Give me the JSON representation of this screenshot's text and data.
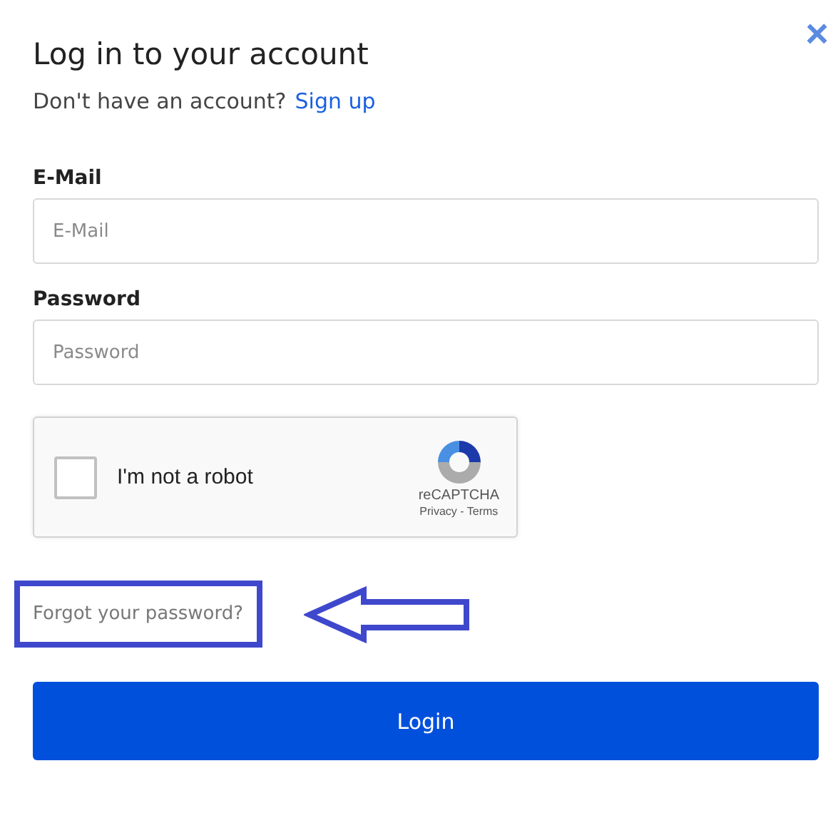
{
  "dialog": {
    "title": "Log in to your account",
    "subtitle": "Don't have an account?",
    "signup_link": "Sign up",
    "close": "×"
  },
  "fields": [
    {
      "label": "E-Mail",
      "placeholder": "E-Mail"
    },
    {
      "label": "Password",
      "placeholder": "Password"
    }
  ],
  "captcha": {
    "label": "I'm not a robot",
    "checked": false,
    "brand": "reCAPTCHA",
    "links": "Privacy - Terms"
  },
  "forgot_link": "Forgot your password?",
  "annotation": {
    "highlighted": true
  },
  "login_button": "Login"
}
